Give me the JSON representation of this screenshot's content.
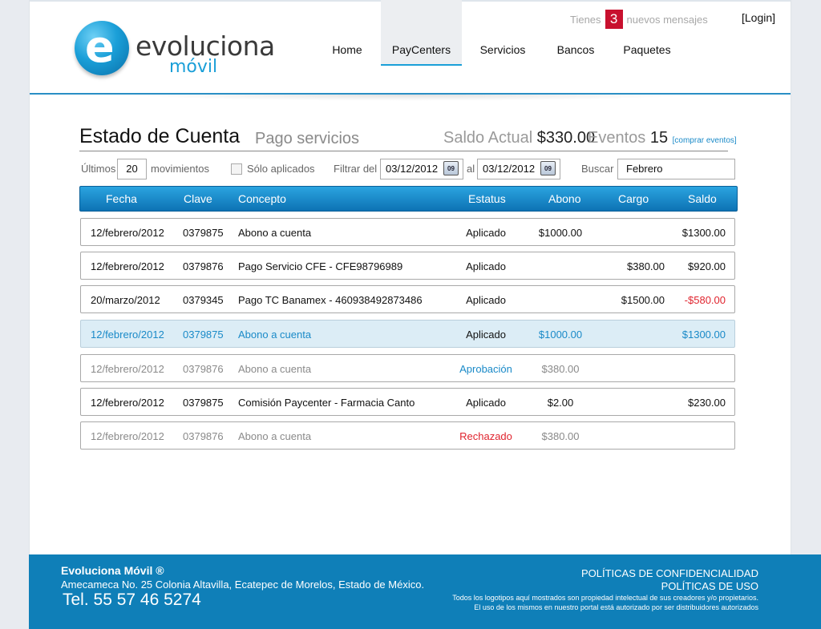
{
  "header": {
    "logo_word": "evoluciona",
    "logo_sub": "móvil",
    "messages_prefix": "Tienes",
    "messages_count": "3",
    "messages_suffix": "nuevos mensajes",
    "login": "[Login]",
    "nav": [
      {
        "label": "Home",
        "active": false
      },
      {
        "label": "PayCenters",
        "active": true
      },
      {
        "label": "Servicios",
        "active": false
      },
      {
        "label": "Bancos",
        "active": false
      },
      {
        "label": "Paquetes",
        "active": false
      }
    ]
  },
  "main": {
    "title": "Estado de Cuenta",
    "subtitle": "Pago servicios",
    "saldo_label": "Saldo Actual",
    "saldo_value": "$330.00",
    "eventos_label": "Eventos",
    "eventos_value": "15",
    "eventos_link": "[comprar eventos]"
  },
  "filters": {
    "ultimos_label": "Últimos",
    "ultimos_value": "20",
    "movimientos_label": "movimientos",
    "solo_aplicados_label": "Sólo aplicados",
    "filtrar_label": "Filtrar del",
    "date_from": "03/12/2012",
    "al_label": "al",
    "date_to": "03/12/2012",
    "calendar_label": "09",
    "buscar_label": "Buscar",
    "buscar_value": "Febrero"
  },
  "table": {
    "headers": [
      "Fecha",
      "Clave",
      "Concepto",
      "Estatus",
      "Abono",
      "Cargo",
      "Saldo"
    ],
    "rows": [
      {
        "fecha": "12/febrero/2012",
        "clave": "0379875",
        "concepto": "Abono a cuenta",
        "estatus": "Aplicado",
        "abono": "$1000.00",
        "cargo": "",
        "saldo": "$1300.00",
        "style": "normal"
      },
      {
        "fecha": "12/febrero/2012",
        "clave": "0379876",
        "concepto": "Pago Servicio CFE - CFE98796989",
        "estatus": "Aplicado",
        "abono": "",
        "cargo": "$380.00",
        "saldo": "$920.00",
        "style": "normal"
      },
      {
        "fecha": "20/marzo/2012",
        "clave": "0379345",
        "concepto": "Pago TC Banamex - 460938492873486",
        "estatus": "Aplicado",
        "abono": "",
        "cargo": "$1500.00",
        "saldo": "-$580.00",
        "style": "normal"
      },
      {
        "fecha": "12/febrero/2012",
        "clave": "0379875",
        "concepto": "Abono a cuenta",
        "estatus": "Aplicado",
        "abono": "$1000.00",
        "cargo": "",
        "saldo": "$1300.00",
        "style": "highlight"
      },
      {
        "fecha": "12/febrero/2012",
        "clave": "0379876",
        "concepto": "Abono a cuenta",
        "estatus": "Aprobación",
        "abono": "$380.00",
        "cargo": "",
        "saldo": "",
        "style": "muted"
      },
      {
        "fecha": "12/febrero/2012",
        "clave": "0379875",
        "concepto": "Comisión Paycenter - Farmacia Canto",
        "estatus": "Aplicado",
        "abono": "$2.00",
        "cargo": "",
        "saldo": "$230.00",
        "style": "normal"
      },
      {
        "fecha": "12/febrero/2012",
        "clave": "0379876",
        "concepto": "Abono a cuenta",
        "estatus": "Rechazado",
        "abono": "$380.00",
        "cargo": "",
        "saldo": "",
        "style": "muted"
      }
    ]
  },
  "footer": {
    "company": "Evoluciona Móvil ®",
    "address": "Amecameca No. 25 Colonia Altavilla, Ecatepec de Morelos, Estado de México.",
    "phone": "Tel. 55 57 46 5274",
    "privacy": "POLÍTICAS DE CONFIDENCIALIDAD",
    "usage": "POLÍTICAS DE USO",
    "disclaimer1": "Todos los logotipos aquí mostrados son propiedad intelectual de sus creadores y/o propietarios.",
    "disclaimer2": "El uso de los mismos en nuestro portal está autorizado por ser distribuidores autorizados"
  },
  "colors": {
    "brand_blue": "#1a9fd8",
    "header_bar": "#0d72b4",
    "footer_bg": "#0f7fb8",
    "badge_red": "#c8102e",
    "negative_red": "#e0242e",
    "highlight_row": "#dcedf6"
  }
}
